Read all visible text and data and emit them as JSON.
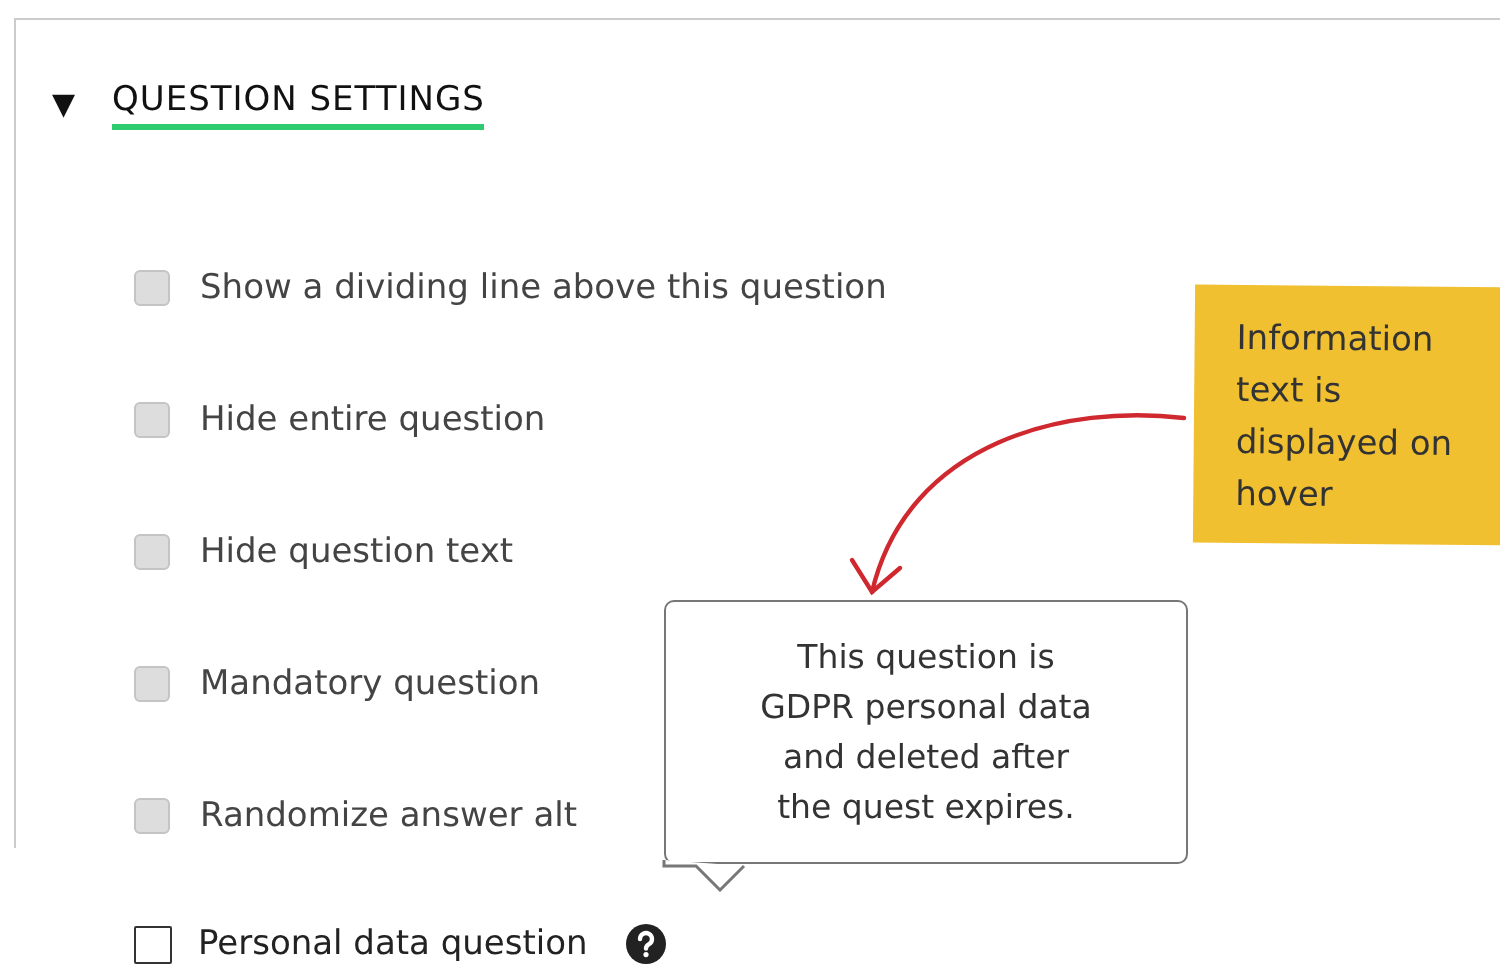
{
  "section": {
    "title": "QUESTION SETTINGS",
    "expanded": true,
    "toggle": "▼"
  },
  "options": [
    {
      "kind": "filled",
      "label": "Show a dividing line above this question",
      "checked": false
    },
    {
      "kind": "filled",
      "label": "Hide entire question",
      "checked": false
    },
    {
      "kind": "filled",
      "label": "Hide question text",
      "checked": false
    },
    {
      "kind": "filled",
      "label": "Mandatory question",
      "checked": false
    },
    {
      "kind": "filled",
      "label": "Randomize answer alt",
      "checked": false
    }
  ],
  "personal": {
    "kind": "outline",
    "label": "Personal data question",
    "checked": false
  },
  "tooltip": {
    "text": "This question is GDPR personal data and deleted after the quest expires."
  },
  "note": {
    "text": "Information text is displayed on hover"
  }
}
